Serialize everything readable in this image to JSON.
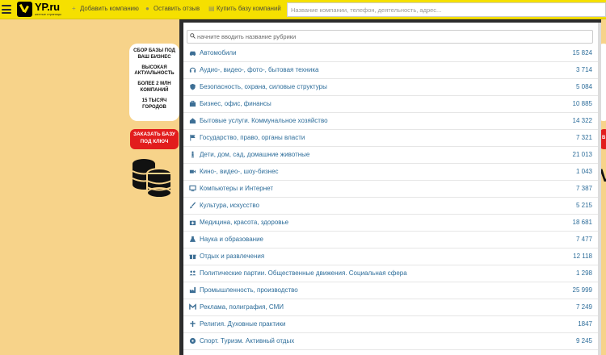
{
  "header": {
    "logo_title": "YP.ru",
    "logo_subtitle": "желтые страницы",
    "add_company": "Добавить компанию",
    "leave_review": "Оставить отзыв",
    "buy_base": "Купить базу компаний",
    "search_placeholder": "Название компании, телефон, деятельность, адрес..."
  },
  "promo": {
    "line1": "СБОР БАЗЫ ПОД ВАШ БИЗНЕС",
    "line2": "ВЫСОКАЯ АКТУАЛЬНОСТЬ",
    "line3": "БОЛЕЕ 2 МЛН КОМПАНИЙ",
    "line4": "15 ТЫСЯЧ ГОРОДОВ",
    "order_button": "ЗАКАЗАТЬ БАЗУ ПОД КЛЮЧ"
  },
  "rubric_search_placeholder": "начните вводить название рубрики",
  "categories": [
    {
      "label": "Автомобили",
      "count": "15 824",
      "icon": "car-icon"
    },
    {
      "label": "Аудио-, видео-, фото-, бытовая техника",
      "count": "3 714",
      "icon": "headphones-icon"
    },
    {
      "label": "Безопасность, охрана, силовые структуры",
      "count": "5 084",
      "icon": "shield-icon"
    },
    {
      "label": "Бизнес, офис, финансы",
      "count": "10 885",
      "icon": "briefcase-icon"
    },
    {
      "label": "Бытовые услуги. Коммунальное хозяйство",
      "count": "14 322",
      "icon": "home-icon"
    },
    {
      "label": "Государство, право, органы власти",
      "count": "7 321",
      "icon": "flag-icon"
    },
    {
      "label": "Дети, дом, сад, домашние животные",
      "count": "21 013",
      "icon": "child-icon"
    },
    {
      "label": "Кино-, видео-, шоу-бизнес",
      "count": "1 043",
      "icon": "video-camera-icon"
    },
    {
      "label": "Компьютеры и Интернет",
      "count": "7 387",
      "icon": "monitor-icon"
    },
    {
      "label": "Культура, искусство",
      "count": "5 215",
      "icon": "brush-icon"
    },
    {
      "label": "Медицина, красота, здоровье",
      "count": "18 681",
      "icon": "medkit-icon"
    },
    {
      "label": "Наука и образование",
      "count": "7 477",
      "icon": "flask-icon"
    },
    {
      "label": "Отдых и развлечения",
      "count": "12 118",
      "icon": "gift-icon"
    },
    {
      "label": "Политические партии. Общественные движения. Социальная сфера",
      "count": "1 298",
      "icon": "users-icon"
    },
    {
      "label": "Промышленность, производство",
      "count": "25 999",
      "icon": "factory-icon"
    },
    {
      "label": "Реклама, полиграфия, СМИ",
      "count": "7 249",
      "icon": "media-icon"
    },
    {
      "label": "Религия. Духовные практики",
      "count": "1847",
      "icon": "cross-icon"
    },
    {
      "label": "Спорт. Туризм. Активный отдых",
      "count": "9 245",
      "icon": "ball-icon"
    }
  ],
  "colors": {
    "header_bg": "#f5e000",
    "page_bg": "#f7d38a",
    "link": "#2d6d9a",
    "order_button": "#e21d1d"
  }
}
